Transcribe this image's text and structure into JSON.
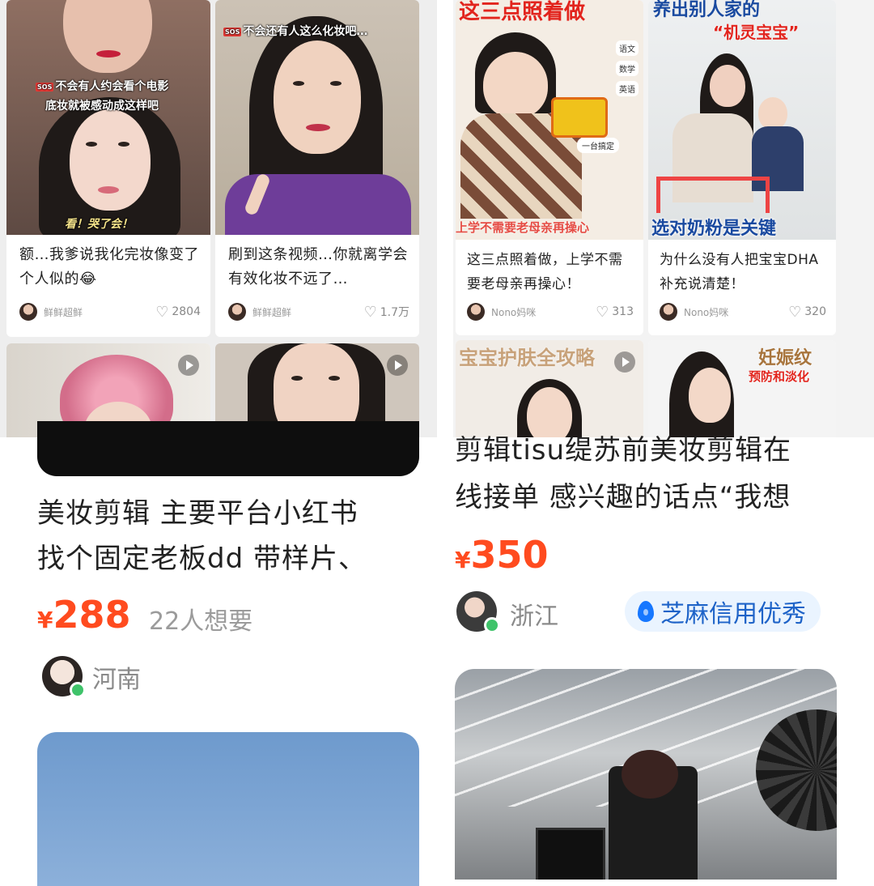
{
  "left_panel": {
    "cards": [
      {
        "overlay_top": "",
        "overlay_badge": "SOS",
        "overlay_line1": "不会有人约会看个电影",
        "overlay_line2": "底妆就被感动成这样吧",
        "overlay_bottom": "看！哭了会！",
        "title": "额…我爹说我化完妆像变了个人似的😂",
        "author": "鲜鲜超鲜",
        "likes": "2804"
      },
      {
        "overlay_badge": "SOS",
        "overlay_line1": "不会还有人这么化妆吧…",
        "title": "刷到这条视频…你就离学会有效化妆不远了…",
        "author": "鲜鲜超鲜",
        "likes": "1.7万"
      }
    ]
  },
  "right_panel": {
    "cards": [
      {
        "overlay_top": "这三点照着做",
        "tags": [
          "语文",
          "数学",
          "英语"
        ],
        "overlay_chip": "一台搞定",
        "overlay_bottom": "上学不需要老母亲再操心",
        "title": "这三点照着做，上学不需要老母亲再操心！",
        "author": "Nono妈咪",
        "likes": "313"
      },
      {
        "overlay_top": "养出别人家的",
        "overlay_top2": "“机灵宝宝”",
        "overlay_bottom": "选对奶粉是关键",
        "title": "为什么没有人把宝宝DHA补充说清楚！",
        "author": "Nono妈咪",
        "likes": "320"
      },
      {
        "overlay_top": "宝宝护肤全攻略"
      },
      {
        "overlay_top": "妊娠纹",
        "overlay_top2": "预防和淡化"
      }
    ]
  },
  "listing_left": {
    "title": "美妆剪辑 主要平台小红书找个固定老板dd 带样片、",
    "title_line1": "美妆剪辑 主要平台小红书",
    "title_line2": "找个固定老板dd 带样片、",
    "currency": "¥",
    "price": "288",
    "want": "22人想要",
    "location": "河南"
  },
  "listing_right": {
    "title_line1": "剪辑tisu缇苏前美妆剪辑在",
    "title_line2": "线接单 感兴趣的话点“我想",
    "currency": "¥",
    "price": "350",
    "location": "浙江",
    "credit": "芝麻信用优秀"
  },
  "colors": {
    "price": "#ff4b1f",
    "credit_bg": "#eaf4ff",
    "credit_text": "#1e63c8",
    "online": "#3fc36a"
  }
}
